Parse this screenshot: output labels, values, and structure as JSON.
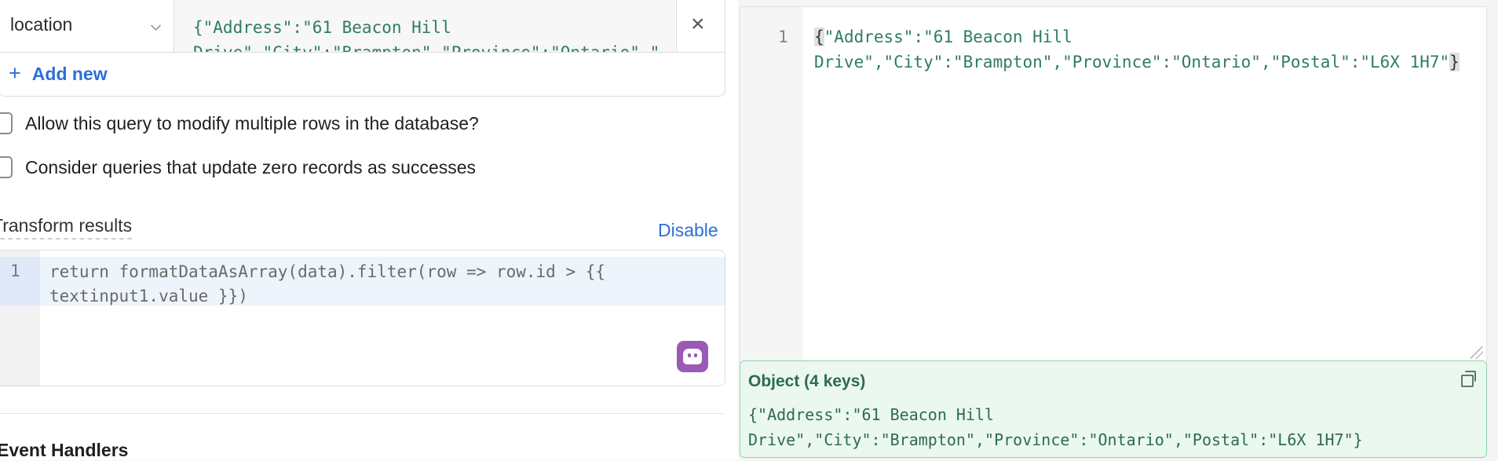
{
  "params": {
    "key": "location",
    "value": "{\"Address\":\"61 Beacon Hill Drive\",\"City\":\"Brampton\",\"Province\":\"Ontario\",\"Postal\":\"L6X 1H7\"}",
    "add_new_label": "Add new"
  },
  "options": {
    "modify_multiple_rows": "Allow this query to modify multiple rows in the database?",
    "zero_records_success": "Consider queries that update zero records as successes"
  },
  "transform": {
    "label": "Transform results",
    "disable_label": "Disable",
    "line_number": "1",
    "code": "return formatDataAsArray(data).filter(row => row.id > {{ textinput1.value }})"
  },
  "event_handlers": {
    "label": "Event Handlers"
  },
  "editor": {
    "line_number": "1",
    "brace_open": "{",
    "body": "\"Address\":\"61 Beacon Hill Drive\",\"City\":\"Brampton\",\"Province\":\"Ontario\",\"Postal\":\"L6X 1H7\"",
    "brace_close": "}"
  },
  "result": {
    "title": "Object (4 keys)",
    "value": "{\"Address\":\"61 Beacon Hill Drive\",\"City\":\"Brampton\",\"Province\":\"Ontario\",\"Postal\":\"L6X 1H7\"}"
  },
  "icons": {
    "chevron": "chevron-down-icon",
    "clear": "close-icon",
    "add": "plus-icon",
    "ai": "robot-icon",
    "copy": "copy-icon"
  },
  "colors": {
    "link_blue": "#2d6fd6",
    "string_green": "#2f7d5b",
    "result_bg": "#eaf8f0",
    "result_border": "#8fd4ac",
    "ai_purple": "#9b59b6"
  }
}
